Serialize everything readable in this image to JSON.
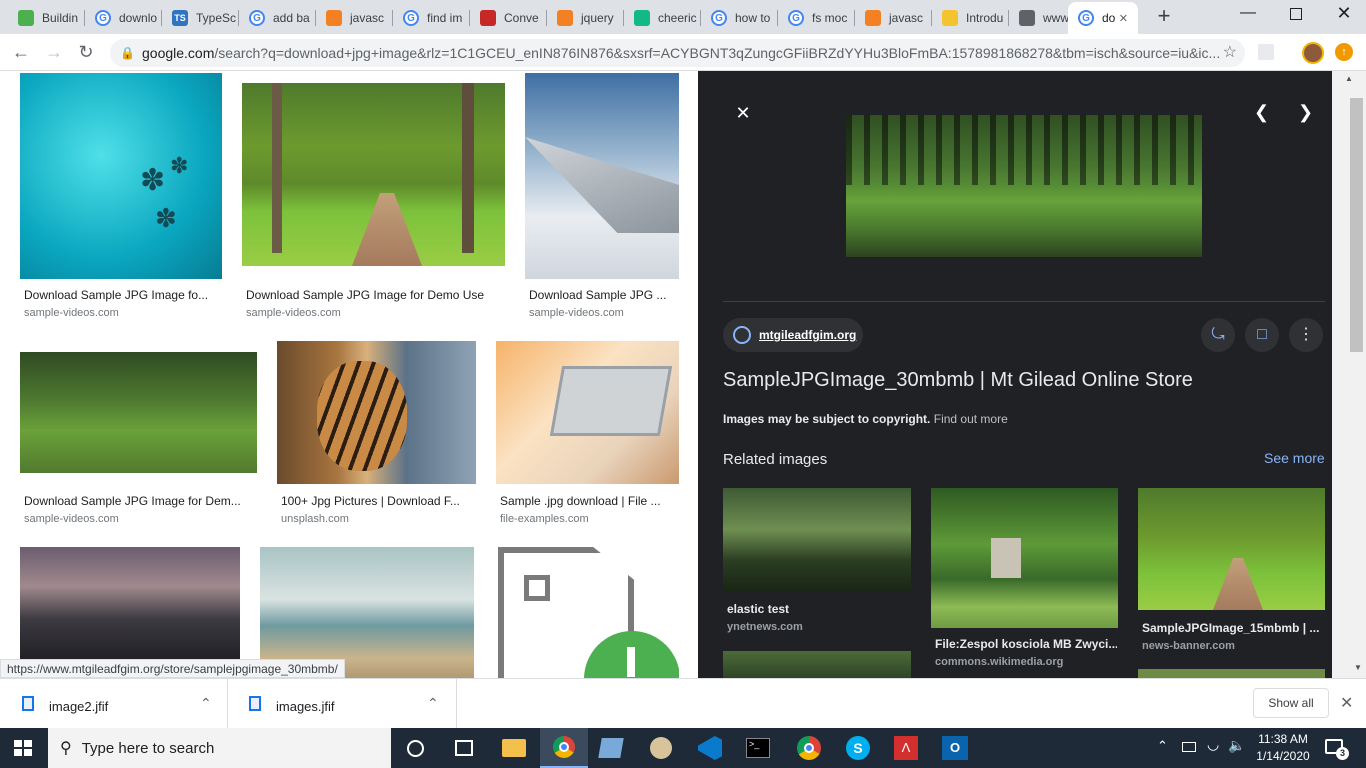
{
  "tabs": [
    {
      "label": "Buildin",
      "icon": "stack-icon"
    },
    {
      "label": "downlo",
      "icon": "google-icon"
    },
    {
      "label": "TypeSc",
      "icon": "typescript-icon"
    },
    {
      "label": "add ba",
      "icon": "google-icon"
    },
    {
      "label": "javasc",
      "icon": "stackoverflow-icon"
    },
    {
      "label": "find im",
      "icon": "google-icon"
    },
    {
      "label": "Conve",
      "icon": "convert-icon"
    },
    {
      "label": "jquery",
      "icon": "stackoverflow-icon"
    },
    {
      "label": "cheeric",
      "icon": "terminal-icon"
    },
    {
      "label": "how to",
      "icon": "google-icon"
    },
    {
      "label": "fs moc",
      "icon": "google-icon"
    },
    {
      "label": "javasc",
      "icon": "stackoverflow-icon"
    },
    {
      "label": "Introdu",
      "icon": "smiley-icon"
    },
    {
      "label": "www.k",
      "icon": "globe-icon"
    },
    {
      "label": "do",
      "icon": "google-icon",
      "active": true
    }
  ],
  "address_bar": {
    "host": "google.com",
    "path": "/search?q=download+jpg+image&rlz=1C1GCEU_enIN876IN876&sxsrf=ACYBGNT3qZungcGFiiBRZdYYHu3BloFmBA:1578981868278&tbm=isch&source=iu&ic..."
  },
  "results": [
    {
      "caption": "Download Sample JPG Image fo...",
      "source": "sample-videos.com"
    },
    {
      "caption": "Download Sample JPG Image for Demo Use",
      "source": "sample-videos.com"
    },
    {
      "caption": "Download Sample JPG ...",
      "source": "sample-videos.com"
    },
    {
      "caption": "Download Sample JPG Image for Dem...",
      "source": "sample-videos.com"
    },
    {
      "caption": "100+ Jpg Pictures | Download F...",
      "source": "unsplash.com"
    },
    {
      "caption": "Sample .jpg download | File ...",
      "source": "file-examples.com"
    }
  ],
  "preview": {
    "site": "mtgileadfgim.org",
    "title": "SampleJPGImage_30mbmb | Mt Gilead Online Store",
    "copyright_text": "Images may be subject to copyright.",
    "find_out_more": "Find out more",
    "related_heading": "Related images",
    "see_more": "See more",
    "related": [
      {
        "caption": "elastic test",
        "source": "ynetnews.com"
      },
      {
        "caption": "File:Zespol kosciola MB Zwyci...",
        "source": "commons.wikimedia.org"
      },
      {
        "caption": "SampleJPGImage_15mbmb | ...",
        "source": "news-banner.com"
      }
    ]
  },
  "status_url": "https://www.mtgileadfgim.org/store/samplejpgimage_30mbmb/",
  "downloads": {
    "items": [
      {
        "name": "image2.jfif"
      },
      {
        "name": "images.jfif"
      }
    ],
    "show_all": "Show all"
  },
  "taskbar": {
    "search_placeholder": "Type here to search",
    "time": "11:38 AM",
    "date": "1/14/2020",
    "notification_count": "3"
  }
}
